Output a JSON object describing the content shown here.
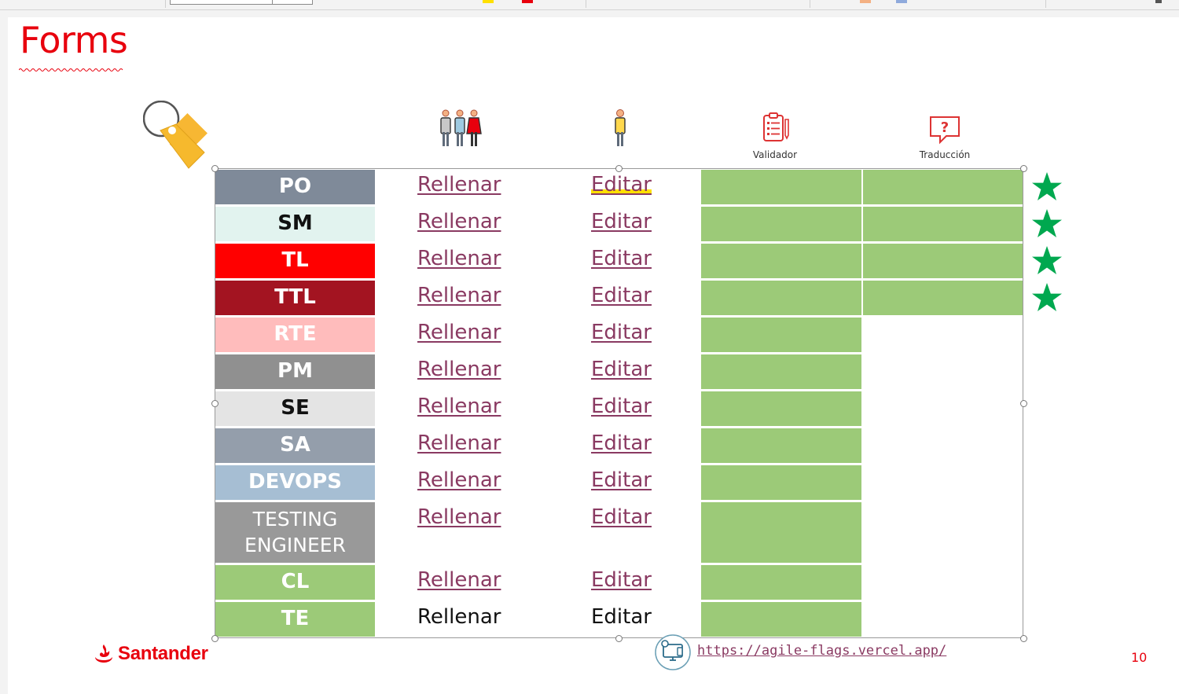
{
  "title": "Forms",
  "icons": {
    "team": "team-people-icon",
    "person": "single-person-icon",
    "validator": "clipboard-checklist-icon",
    "translation": "question-bubble-icon",
    "tag": "price-tag-icon",
    "url": "web-settings-icon"
  },
  "columns": {
    "validator_label": "Validador",
    "translation_label": "Traducción"
  },
  "roles": [
    {
      "code": "PO",
      "bg": "#7f8a99",
      "fg": "#ffffff",
      "fill_label": "Rellenar",
      "edit_label": "Editar",
      "validator": true,
      "translation": true,
      "star": true
    },
    {
      "code": "SM",
      "bg": "#e2f3ef",
      "fg": "#111111",
      "fill_label": "Rellenar",
      "edit_label": "Editar",
      "validator": true,
      "translation": true,
      "star": true
    },
    {
      "code": "TL",
      "bg": "#ff0000",
      "fg": "#ffffff",
      "fill_label": "Rellenar",
      "edit_label": "Editar",
      "validator": true,
      "translation": true,
      "star": true
    },
    {
      "code": "TTL",
      "bg": "#a31421",
      "fg": "#ffffff",
      "fill_label": "Rellenar",
      "edit_label": "Editar",
      "validator": true,
      "translation": true,
      "star": true
    },
    {
      "code": "RTE",
      "bg": "#ffbcbc",
      "fg": "#ffffff",
      "fill_label": "Rellenar",
      "edit_label": "Editar",
      "validator": true,
      "translation": false,
      "star": false
    },
    {
      "code": "PM",
      "bg": "#909090",
      "fg": "#ffffff",
      "fill_label": "Rellenar",
      "edit_label": "Editar",
      "validator": true,
      "translation": false,
      "star": false
    },
    {
      "code": "SE",
      "bg": "#e4e4e4",
      "fg": "#111111",
      "fill_label": "Rellenar",
      "edit_label": "Editar",
      "validator": true,
      "translation": false,
      "star": false
    },
    {
      "code": "SA",
      "bg": "#949eab",
      "fg": "#ffffff",
      "fill_label": "Rellenar",
      "edit_label": "Editar",
      "validator": true,
      "translation": false,
      "star": false
    },
    {
      "code": "DEVOPS",
      "bg": "#a6bed3",
      "fg": "#ffffff",
      "fill_label": "Rellenar",
      "edit_label": "Editar",
      "validator": true,
      "translation": false,
      "star": false
    },
    {
      "code": "TESTING ENGINEER",
      "bg": "#999999",
      "fg": "#ffffff",
      "fill_label": "Rellenar",
      "edit_label": "Editar",
      "validator": true,
      "translation": false,
      "star": false,
      "plain": true
    },
    {
      "code": "CL",
      "bg": "#9cca78",
      "fg": "#ffffff",
      "fill_label": "Rellenar",
      "edit_label": "Editar",
      "validator": true,
      "translation": false,
      "star": false
    },
    {
      "code": "TE",
      "bg": "#9cca78",
      "fg": "#ffffff",
      "fill_label": "Rellenar",
      "edit_label": "Editar",
      "validator": true,
      "translation": false,
      "star": false,
      "no_link": true
    }
  ],
  "colors": {
    "accent": "#e8000d",
    "cell_green": "#9cca78",
    "star_green": "#00a84f",
    "link": "#8a3a62"
  },
  "footer": {
    "brand": "Santander",
    "url": "https://agile-flags.vercel.app/",
    "page_number": "10"
  }
}
